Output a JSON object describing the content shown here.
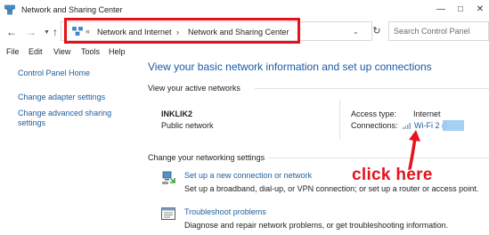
{
  "window": {
    "title": "Network and Sharing Center"
  },
  "address_bar": {
    "prefix": "«",
    "crumbs": [
      "Network and Internet",
      "Network and Sharing Center"
    ],
    "separator": "›"
  },
  "search": {
    "placeholder": "Search Control Panel"
  },
  "menu": [
    "File",
    "Edit",
    "View",
    "Tools",
    "Help"
  ],
  "sidebar": {
    "items": [
      {
        "label": "Control Panel Home"
      },
      {
        "label": "Change adapter settings"
      },
      {
        "label": "Change advanced sharing settings",
        "lines": [
          "Change advanced sharing",
          "settings"
        ]
      }
    ]
  },
  "main": {
    "heading": "View your basic network information and set up connections",
    "active_section": "View your active networks",
    "network": {
      "name": "INKLIK2",
      "type": "Public network",
      "access_label": "Access type:",
      "access_value": "Internet",
      "connections_label": "Connections:",
      "connection_value": "Wi-Fi 2 (I"
    },
    "change_section": "Change your networking settings",
    "tasks": [
      {
        "link": "Set up a new connection or network",
        "desc": "Set up a broadband, dial-up, or VPN connection; or set up a router or access point."
      },
      {
        "link": "Troubleshoot problems",
        "desc": "Diagnose and repair network problems, or get troubleshooting information."
      }
    ]
  },
  "annotation": {
    "text": "click here",
    "color": "#e8111a"
  },
  "colors": {
    "link": "#1d5d9b",
    "heading": "#1a5aa6",
    "highlight": "#e8111a"
  }
}
